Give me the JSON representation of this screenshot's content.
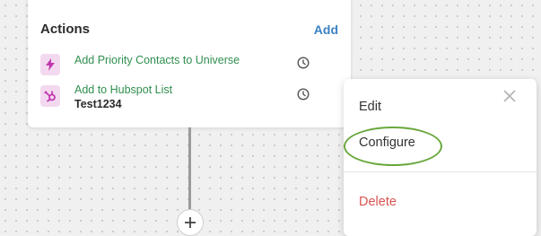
{
  "card": {
    "title": "Actions",
    "add_label": "Add",
    "actions": [
      {
        "label": "Add Priority Contacts to Universe",
        "sub": "",
        "icon": "lightning-icon"
      },
      {
        "label": "Add to Hubspot List",
        "sub": "Test1234",
        "icon": "hubspot-icon"
      }
    ]
  },
  "menu": {
    "edit_label": "Edit",
    "configure_label": "Configure",
    "delete_label": "Delete"
  },
  "colors": {
    "accent": "#3b82c4",
    "action_text": "#2f8f4e",
    "icon_bg": "#f3d9ef",
    "icon_fg": "#c03ab0",
    "delete": "#d9534f",
    "highlight": "#6aa83e"
  }
}
